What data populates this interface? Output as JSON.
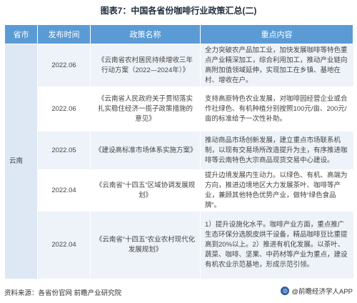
{
  "title": "图表7：中国各省份咖啡行业政策汇总(二)",
  "table": {
    "headers": [
      "省市",
      "发布时间",
      "政策名称",
      "重点内容"
    ],
    "province": "云南",
    "rows": [
      {
        "date": "2022.06",
        "name": "《云南省农村居民持续增收三年行动方案（2022—2024年）》",
        "points": "全力突破农产品加工业，加快发展咖啡等特色重点产业精深加工，综合利用加工，推动产业链向高附加值领域延伸，实现加工在乡镇、基地在村、增收在户。"
      },
      {
        "date": "2022.06",
        "name": "《云南省人民政府关于贯彻落实扎实稳住经济一揽子政策措施的意见》",
        "points": "支持高原特色农业发展，对咖啡园经营企业或合作社绿色、有机种植分别按照100元/亩、200元/亩的标准给予一次性补助。"
      },
      {
        "date": "2022.05",
        "name": "《建设高标准市场体系实施方案》",
        "points": "推动商品市场创新发展，建立重点市场联系机制，以现有交易场所改造提升为主，有序推进咖啡等云南特色大宗商品现货交易中心建设。"
      },
      {
        "date": "2022.04",
        "name": "《云南省“十四五”区域协调发展规划》",
        "points": "提升边境发展内生动力。以绿色、有机、高端为方向，推进边境地区大力发展茶叶、咖啡等产业，兼顾其他特色优势产业，做特“绿色食品牌”。"
      },
      {
        "date": "2022.04",
        "name": "《云南省“十四五”农业农村现代化发展规划》",
        "points": "1）提升设施化水平。咖啡产业方面，重点推广生态环保分选脱皮烘干设备，精品咖啡豆比重提高到20%以上。2）推进有机化发展。以茶叶、蔬菜、咖啡、坚果、中药材等产业为重点，建设有机农业示范基地，形成示范引领。"
      }
    ]
  },
  "footer": {
    "source": "资料来源：各省份官网 前瞻产业研究院",
    "brand": "@前瞻经济学人APP"
  }
}
